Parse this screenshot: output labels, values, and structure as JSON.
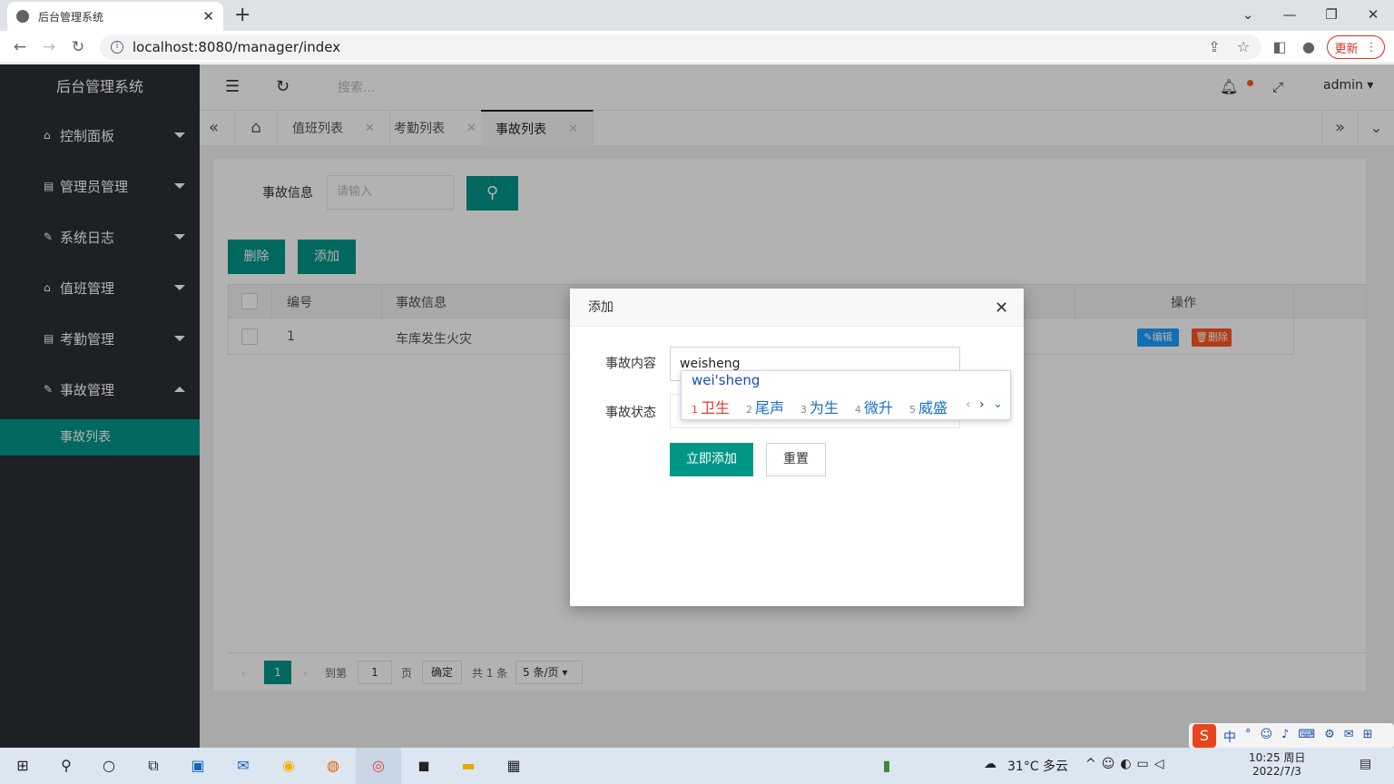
{
  "browser": {
    "tab_title": "后台管理系统",
    "tab_close": "✕",
    "new_tab": "+",
    "url": "localhost:8080/manager/index",
    "update_label": "更新"
  },
  "sidebar": {
    "brand": "后台管理系统",
    "items": [
      {
        "label": "控制面板",
        "icon": "home-icon"
      },
      {
        "label": "管理员管理",
        "icon": "book-icon"
      },
      {
        "label": "系统日志",
        "icon": "pencil-icon"
      },
      {
        "label": "值班管理",
        "icon": "home-icon"
      },
      {
        "label": "考勤管理",
        "icon": "book-icon"
      },
      {
        "label": "事故管理",
        "icon": "pencil-icon"
      }
    ],
    "active_sub": "事故列表"
  },
  "header": {
    "search_placeholder": "搜索...",
    "user": "admin"
  },
  "page_tabs": [
    {
      "label": "值班列表"
    },
    {
      "label": "考勤列表"
    },
    {
      "label": "事故列表"
    }
  ],
  "filter": {
    "label": "事故信息",
    "placeholder": "请输入"
  },
  "actions": {
    "delete": "删除",
    "add": "添加"
  },
  "table": {
    "headers": [
      "编号",
      "事故信息",
      "操作"
    ],
    "rows": [
      {
        "id": "1",
        "info": "车库发生火灾",
        "edit": "编辑",
        "delete": "删除"
      }
    ]
  },
  "pagination": {
    "current": "1",
    "goto": "到第",
    "page_input": "1",
    "page_unit": "页",
    "confirm": "确定",
    "total": "共 1 条",
    "per_page": "5 条/页"
  },
  "dialog": {
    "title": "添加",
    "content_label": "事故内容",
    "content_value": "weisheng",
    "status_label": "事故状态",
    "submit": "立即添加",
    "reset": "重置"
  },
  "ime": {
    "pinyin": "wei'sheng",
    "candidates": [
      {
        "n": "1",
        "text": "卫生"
      },
      {
        "n": "2",
        "text": "尾声"
      },
      {
        "n": "3",
        "text": "为生"
      },
      {
        "n": "4",
        "text": "微升"
      },
      {
        "n": "5",
        "text": "威盛"
      }
    ]
  },
  "taskbar": {
    "weather": "31°C 多云",
    "time": "10:25 周日",
    "date": "2022/7/3",
    "ime_lang": "中"
  },
  "colors": {
    "primary": "#009688",
    "sidebar": "#2a3035",
    "danger": "#ff5722",
    "info": "#1e9fff"
  }
}
